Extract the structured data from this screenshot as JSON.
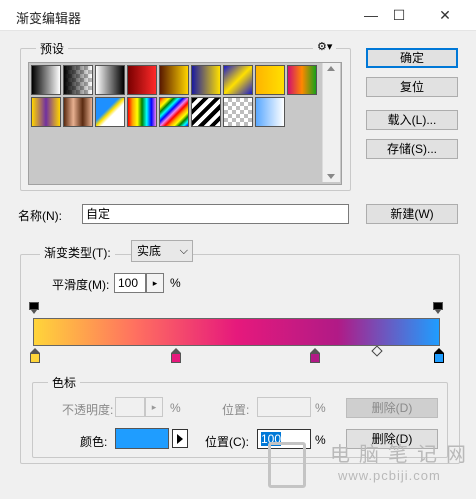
{
  "window": {
    "title": "渐变编辑器",
    "minimize_glyph": "—",
    "maximize_glyph": "☐",
    "close_glyph": "✕"
  },
  "presets": {
    "label": "预设",
    "gear_glyph": "⚙▾",
    "swatches": [
      "linear-gradient(to right,#000,#fff)",
      "linear-gradient(to right,#000,transparent)",
      "linear-gradient(to right,#fff,#000)",
      "linear-gradient(to right,#7a0000,#ff2a2a)",
      "linear-gradient(to right,#5a1a00,#ffd400)",
      "linear-gradient(to right,#1a1aa0,#ffe000)",
      "linear-gradient(135deg,#1a1acc,#ffe000 50%,#1a1acc)",
      "linear-gradient(to right,#ffb400,#ffe000)",
      "linear-gradient(to right,#d01070,#ff8800,#18a018)",
      "linear-gradient(to right,#ffd400,#7030a0,#ffd400)",
      "linear-gradient(to right,#5a2a10,#e8b090,#5a2a10,#e8b090)",
      "linear-gradient(135deg,#1e90ff 40%,#ffe000 50%,#ffffff 60%)",
      "linear-gradient(to right,red,orange,yellow,green,cyan,blue,violet)",
      "linear-gradient(135deg,red,orange,yellow,green,cyan,blue,violet,red,orange,yellow,green,cyan,blue)",
      "repeating-linear-gradient(135deg,#000 0 4px,#fff 4px 8px)",
      "checker",
      "linear-gradient(to right,#5aa8ff,#ffffff)"
    ]
  },
  "buttons": {
    "ok": "确定",
    "reset": "复位",
    "load": "载入(L)...",
    "save": "存储(S)...",
    "new": "新建(W)"
  },
  "name": {
    "label": "名称(N):",
    "value": "自定"
  },
  "gradient": {
    "type_label": "渐变类型(T):",
    "type_value": "实底",
    "smooth_label": "平滑度(M):",
    "smooth_value": "100",
    "percent": "%",
    "colors": [
      "#ffd53a",
      "#ff7060",
      "#e6197c",
      "#b11a86",
      "#1f9dff"
    ]
  },
  "stops": {
    "group_label": "色标",
    "opacity_label": "不透明度:",
    "opacity_value": "",
    "opacity_pos_label": "位置:",
    "opacity_pos_value": "",
    "delete_label": "删除(D)",
    "color_label": "颜色:",
    "color_value": "#1f9dff",
    "color_pos_label": "位置(C):",
    "color_pos_value": "100"
  },
  "watermark": {
    "title": "电脑笔记网",
    "url": "www.pcbiji.com"
  }
}
